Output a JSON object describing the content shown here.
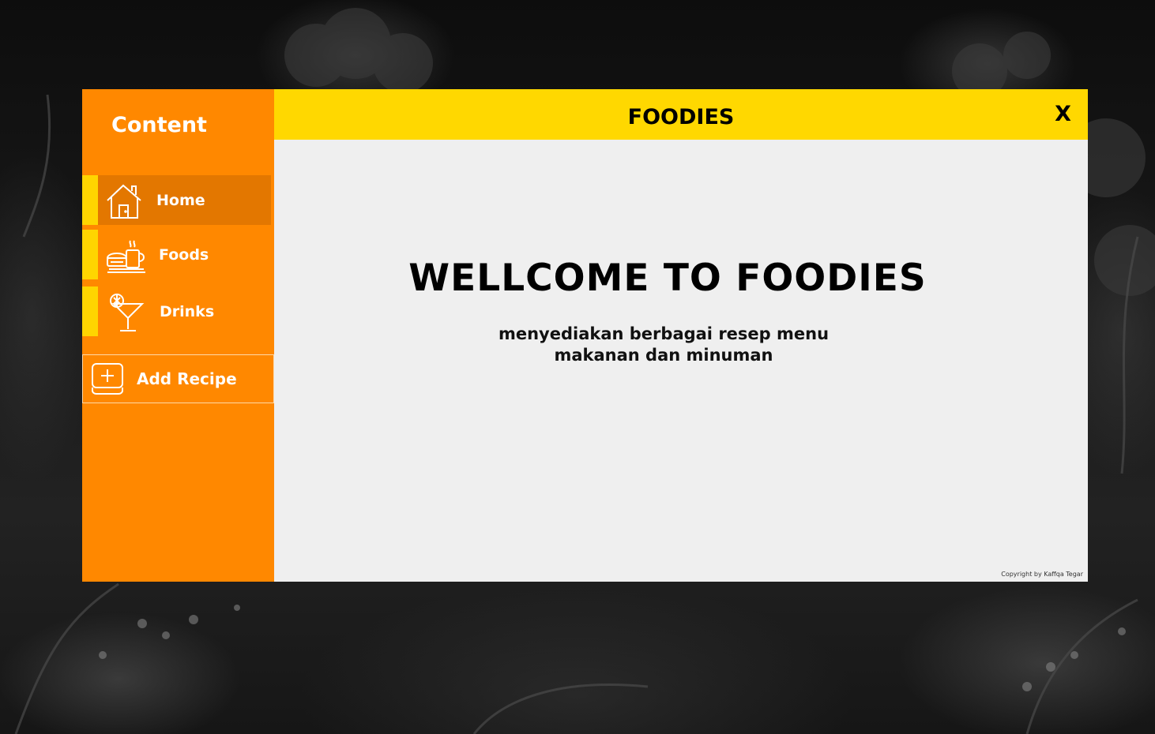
{
  "app": {
    "title": "FOODIES",
    "close_label": "X"
  },
  "sidebar": {
    "title": "Content",
    "items": [
      {
        "label": "Home",
        "icon": "home-icon",
        "active": true
      },
      {
        "label": "Foods",
        "icon": "food-icon",
        "active": false
      },
      {
        "label": "Drinks",
        "icon": "cocktail-icon",
        "active": false
      }
    ],
    "add_recipe": {
      "label": "Add Recipe",
      "icon": "add-icon"
    }
  },
  "main": {
    "heading": "WELLCOME TO FOODIES",
    "subtitle_line1": "menyediakan berbagai resep menu",
    "subtitle_line2": "makanan dan minuman",
    "copyright": "Copyright by Kaffqa Tegar"
  },
  "colors": {
    "sidebar": "#ff8800",
    "sidebar_active": "#e37700",
    "accent": "#ffd500",
    "topbar": "#ffd800",
    "content_bg": "#efefef"
  }
}
